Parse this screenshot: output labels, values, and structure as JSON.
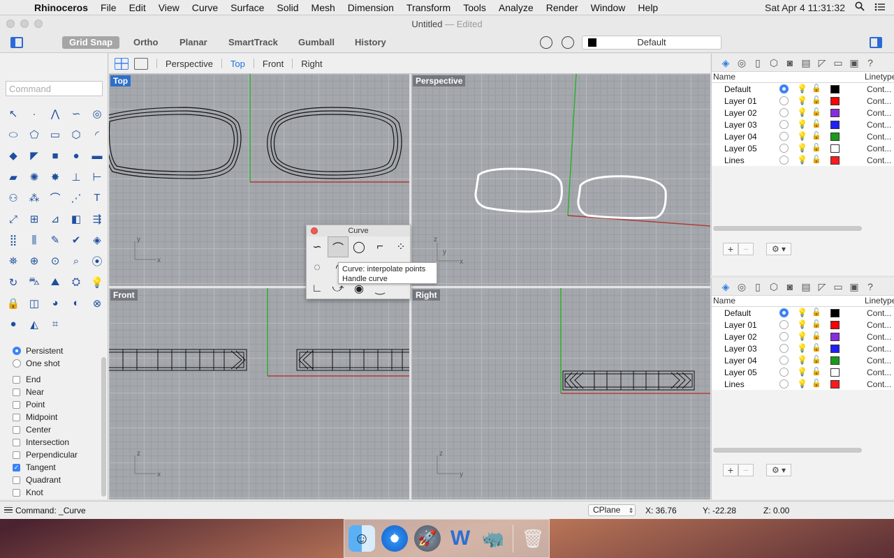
{
  "menubar": {
    "app": "Rhinoceros",
    "items": [
      "File",
      "Edit",
      "View",
      "Curve",
      "Surface",
      "Solid",
      "Mesh",
      "Dimension",
      "Transform",
      "Tools",
      "Analyze",
      "Render",
      "Window",
      "Help"
    ],
    "clock": "Sat Apr 4  11:31:32"
  },
  "window": {
    "title": "Untitled",
    "subtitle": "— Edited"
  },
  "toolbar": {
    "modes": [
      "Grid Snap",
      "Ortho",
      "Planar",
      "SmartTrack",
      "Gumball",
      "History"
    ],
    "active_mode": "Grid Snap",
    "current_layer": "Default"
  },
  "command": {
    "placeholder": "Command"
  },
  "viewport_tabs": {
    "tabs": [
      "Perspective",
      "Top",
      "Front",
      "Right"
    ],
    "active": "Top"
  },
  "viewports": {
    "top": "Top",
    "perspective": "Perspective",
    "front": "Front",
    "right": "Right"
  },
  "axis_labels": {
    "top": [
      "y",
      "x"
    ],
    "perspective": [
      "z",
      "y",
      "x"
    ],
    "front": [
      "z",
      "x"
    ],
    "right": [
      "z",
      "y"
    ]
  },
  "osnap": {
    "modes": [
      {
        "label": "Persistent",
        "checked": true
      },
      {
        "label": "One shot",
        "checked": false
      }
    ],
    "snaps": [
      {
        "label": "End",
        "checked": false
      },
      {
        "label": "Near",
        "checked": false
      },
      {
        "label": "Point",
        "checked": false
      },
      {
        "label": "Midpoint",
        "checked": false
      },
      {
        "label": "Center",
        "checked": false
      },
      {
        "label": "Intersection",
        "checked": false
      },
      {
        "label": "Perpendicular",
        "checked": false
      },
      {
        "label": "Tangent",
        "checked": true
      },
      {
        "label": "Quadrant",
        "checked": false
      },
      {
        "label": "Knot",
        "checked": false
      }
    ]
  },
  "palette": {
    "title": "Curve",
    "tooltip_line1": "Curve: interpolate points",
    "tooltip_line2": "Handle curve"
  },
  "layers": {
    "header_name": "Name",
    "header_linetype": "Linetype",
    "rows": [
      {
        "name": "Default",
        "current": true,
        "color": "#000000",
        "linetype": "Cont..."
      },
      {
        "name": "Layer 01",
        "current": false,
        "color": "#ff0000",
        "linetype": "Cont..."
      },
      {
        "name": "Layer 02",
        "current": false,
        "color": "#8a2be2",
        "linetype": "Cont..."
      },
      {
        "name": "Layer 03",
        "current": false,
        "color": "#1f1fff",
        "linetype": "Cont..."
      },
      {
        "name": "Layer 04",
        "current": false,
        "color": "#1a9a1a",
        "linetype": "Cont..."
      },
      {
        "name": "Layer 05",
        "current": false,
        "color": "#ffffff",
        "linetype": "Cont..."
      },
      {
        "name": "Lines",
        "current": false,
        "color": "#ff1a1a",
        "linetype": "Cont..."
      }
    ]
  },
  "status": {
    "command": "Command: _Curve",
    "cplane": "CPlane",
    "x": "X: 36.76",
    "y": "Y: -22.28",
    "z": "Z: 0.00"
  },
  "colors": {
    "accent": "#2f6fc9",
    "grid_bg": "#a4a8ad",
    "x_axis": "#b03a3a",
    "y_axis": "#2eae2e"
  },
  "dock": [
    "finder-icon",
    "safari-icon",
    "launchpad-icon",
    "word-icon",
    "rhino-icon",
    "trash-icon"
  ]
}
